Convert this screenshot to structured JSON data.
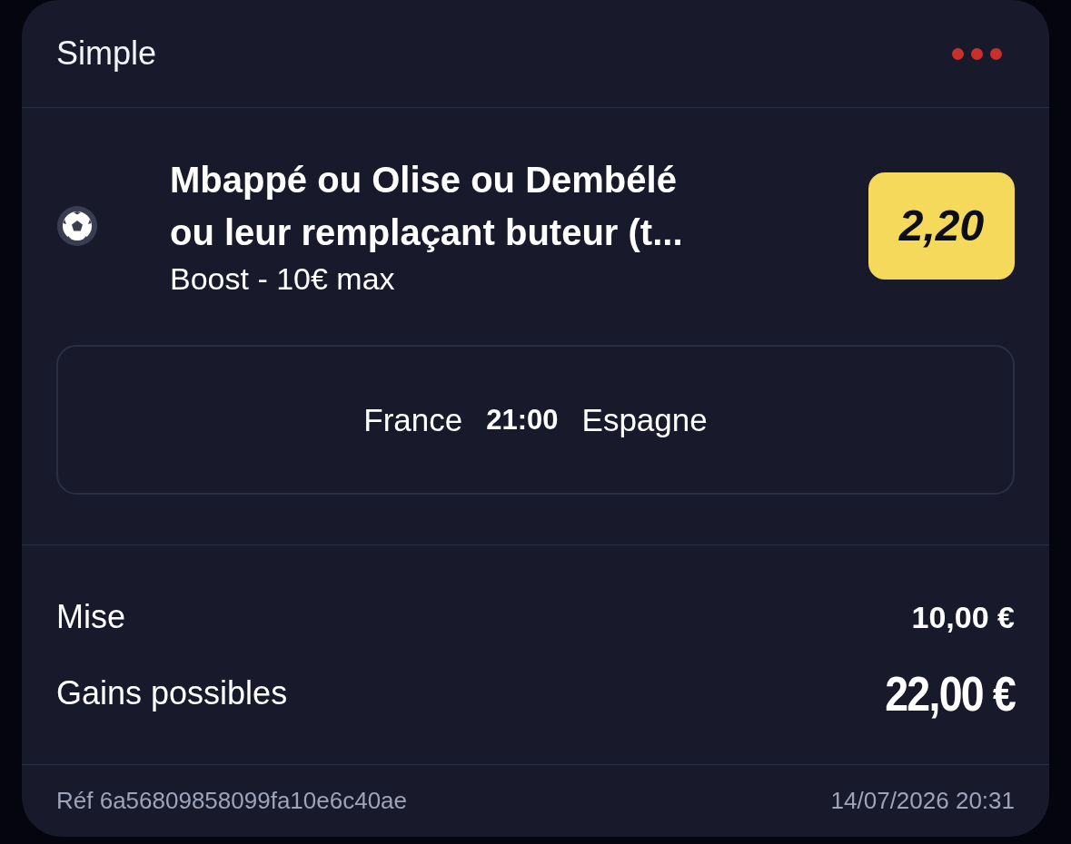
{
  "header": {
    "title": "Simple"
  },
  "selection": {
    "title": "Mbappé ou Olise ou Dembélé ou leur remplaçant buteur (t...",
    "subtitle": "Boost - 10€ max",
    "odds": "2,20"
  },
  "match": {
    "home": "France",
    "time": "21:00",
    "away": "Espagne"
  },
  "summary": [
    {
      "kind": "stake",
      "label": "Mise",
      "value": "10,00 €"
    },
    {
      "kind": "payout",
      "label": "Gains possibles",
      "value": "22,00 €"
    }
  ],
  "footer": {
    "reference": "Réf 6a56809858099fa10e6c40ae",
    "timestamp": "14/07/2026 20:31"
  }
}
